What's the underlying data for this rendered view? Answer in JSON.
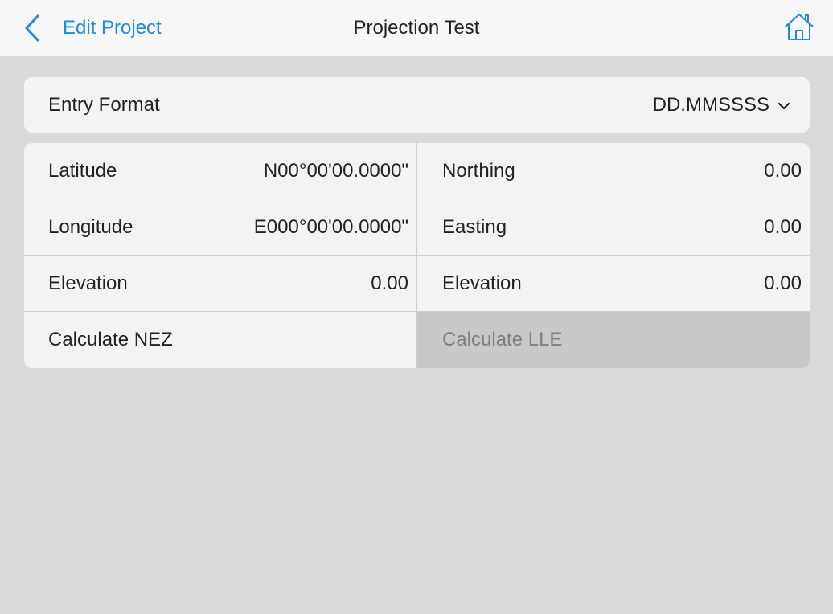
{
  "nav": {
    "back_label": "Edit Project",
    "title": "Projection Test",
    "accent_color": "#1e88e5"
  },
  "entry_format": {
    "label": "Entry Format",
    "value": "DD.MMSSSS"
  },
  "geodetic": {
    "latitude_label": "Latitude",
    "latitude_value": "N00°00'00.0000\"",
    "longitude_label": "Longitude",
    "longitude_value": "E000°00'00.0000\"",
    "elevation_label": "Elevation",
    "elevation_value": "0.00",
    "calculate_label": "Calculate NEZ"
  },
  "grid": {
    "northing_label": "Northing",
    "northing_value": "0.00",
    "easting_label": "Easting",
    "easting_value": "0.00",
    "elevation_label": "Elevation",
    "elevation_value": "0.00",
    "calculate_label": "Calculate LLE",
    "calculate_disabled": true
  },
  "icons": {
    "back": "chevron-left-icon",
    "home": "home-icon",
    "dropdown": "chevron-down-icon"
  }
}
